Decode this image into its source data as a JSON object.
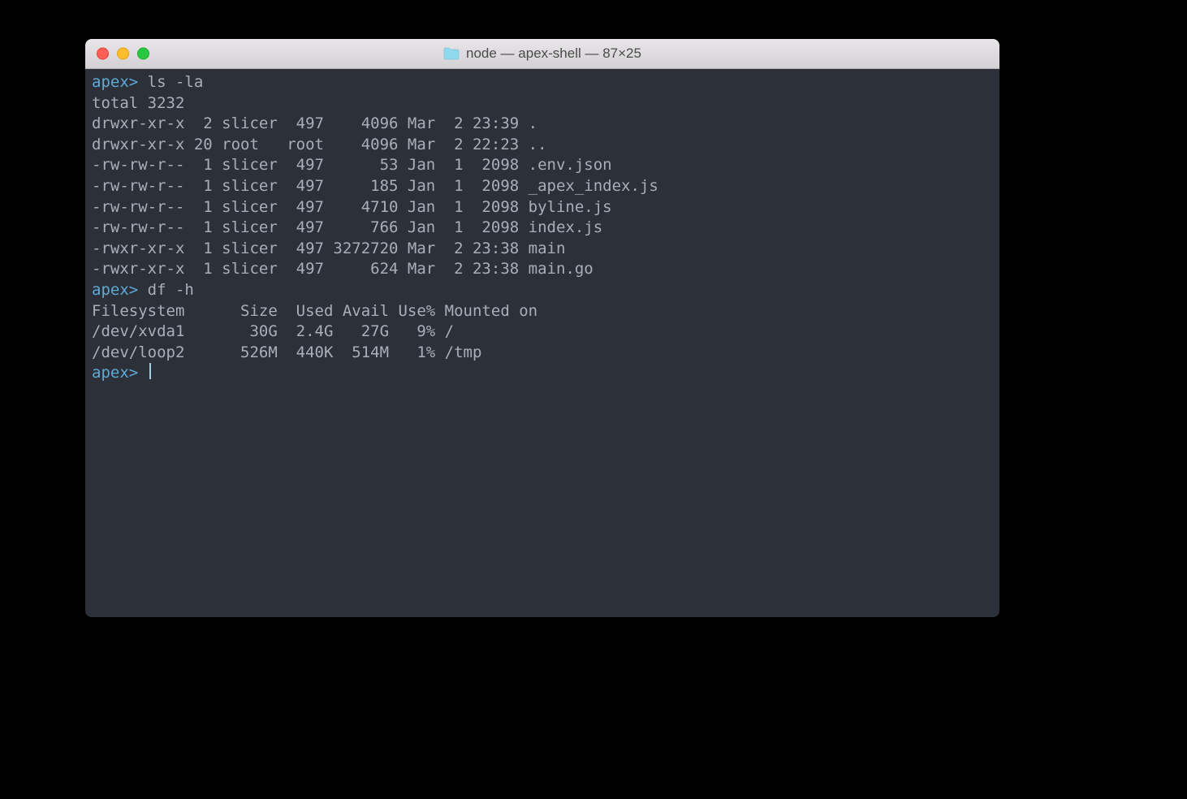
{
  "window": {
    "title": "node — apex-shell — 87×25"
  },
  "prompt": "apex>",
  "session": {
    "entries": [
      {
        "command": "ls -la",
        "output": [
          "total 3232",
          "drwxr-xr-x  2 slicer  497    4096 Mar  2 23:39 .",
          "drwxr-xr-x 20 root   root    4096 Mar  2 22:23 ..",
          "-rw-rw-r--  1 slicer  497      53 Jan  1  2098 .env.json",
          "-rw-rw-r--  1 slicer  497     185 Jan  1  2098 _apex_index.js",
          "-rw-rw-r--  1 slicer  497    4710 Jan  1  2098 byline.js",
          "-rw-rw-r--  1 slicer  497     766 Jan  1  2098 index.js",
          "-rwxr-xr-x  1 slicer  497 3272720 Mar  2 23:38 main",
          "-rwxr-xr-x  1 slicer  497     624 Mar  2 23:38 main.go"
        ]
      },
      {
        "command": "df -h",
        "output": [
          "Filesystem      Size  Used Avail Use% Mounted on",
          "/dev/xvda1       30G  2.4G   27G   9% /",
          "/dev/loop2      526M  440K  514M   1% /tmp"
        ]
      }
    ]
  }
}
